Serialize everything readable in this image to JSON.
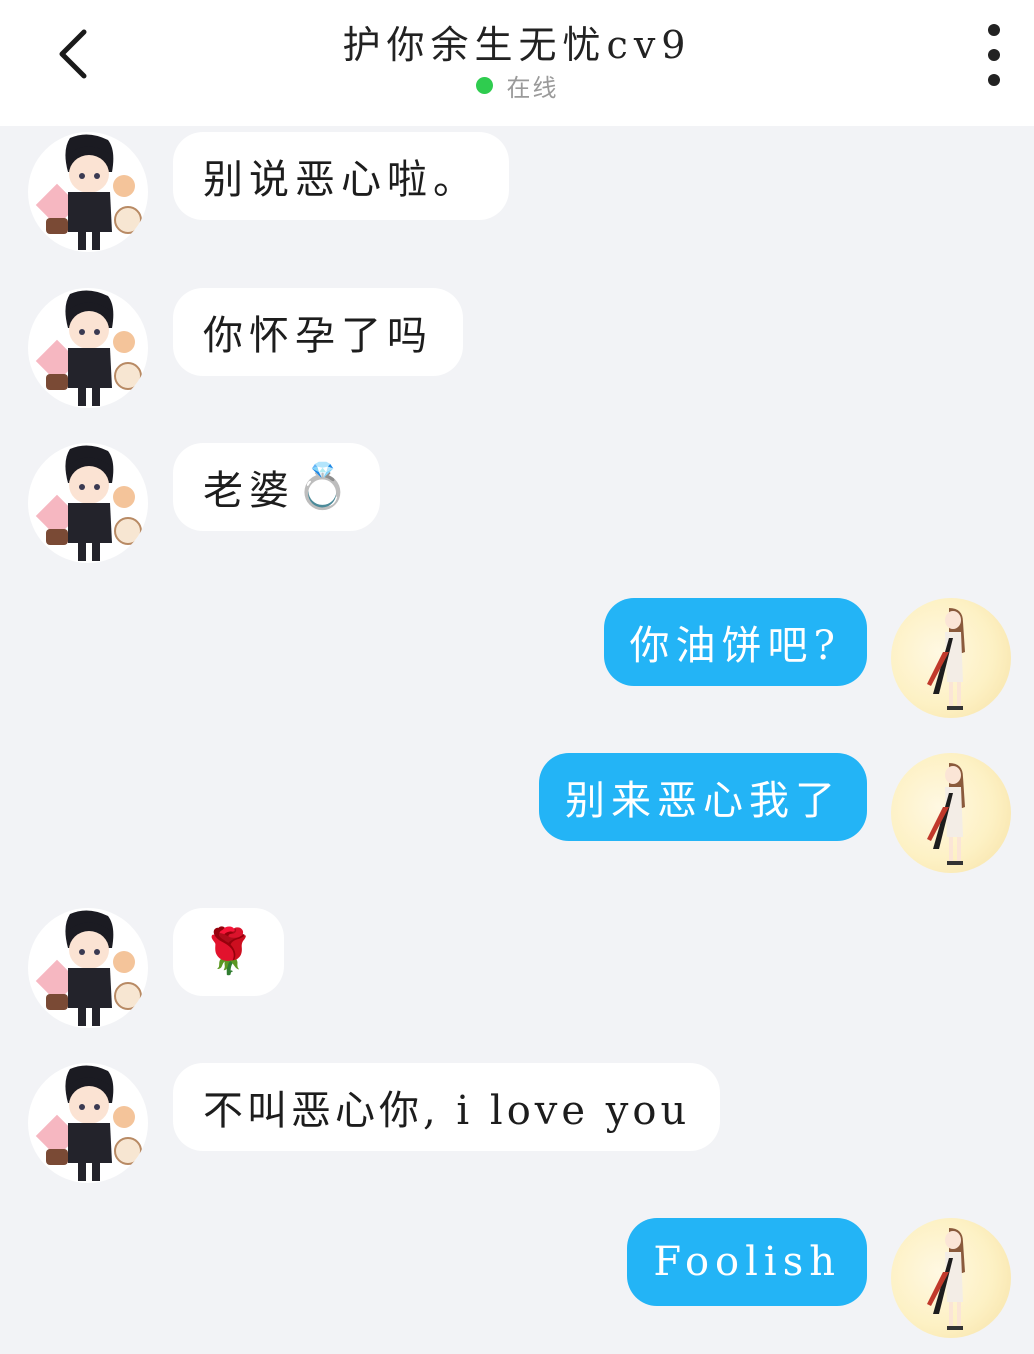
{
  "header": {
    "title": "护你余生无忧cv9",
    "status": "在线",
    "status_color": "#2fcc4f"
  },
  "icons": {
    "back": "chevron-left-icon",
    "more": "vertical-dots-icon",
    "ring": "ring-emoji",
    "rose": "rose-emoji"
  },
  "colors": {
    "outgoing_bubble": "#23b4f6",
    "incoming_bubble": "#ffffff",
    "background": "#f2f3f6"
  },
  "messages": [
    {
      "sender": "contact",
      "text": "别说恶心啦。"
    },
    {
      "sender": "contact",
      "text": "你怀孕了吗"
    },
    {
      "sender": "contact",
      "text": "老婆",
      "emoji": "💍"
    },
    {
      "sender": "me",
      "text": "你油饼吧?"
    },
    {
      "sender": "me",
      "text": "别来恶心我了"
    },
    {
      "sender": "contact",
      "text": "",
      "emoji": "🌹"
    },
    {
      "sender": "contact",
      "text": "不叫恶心你, i love you"
    },
    {
      "sender": "me",
      "text": "Foolish"
    }
  ]
}
